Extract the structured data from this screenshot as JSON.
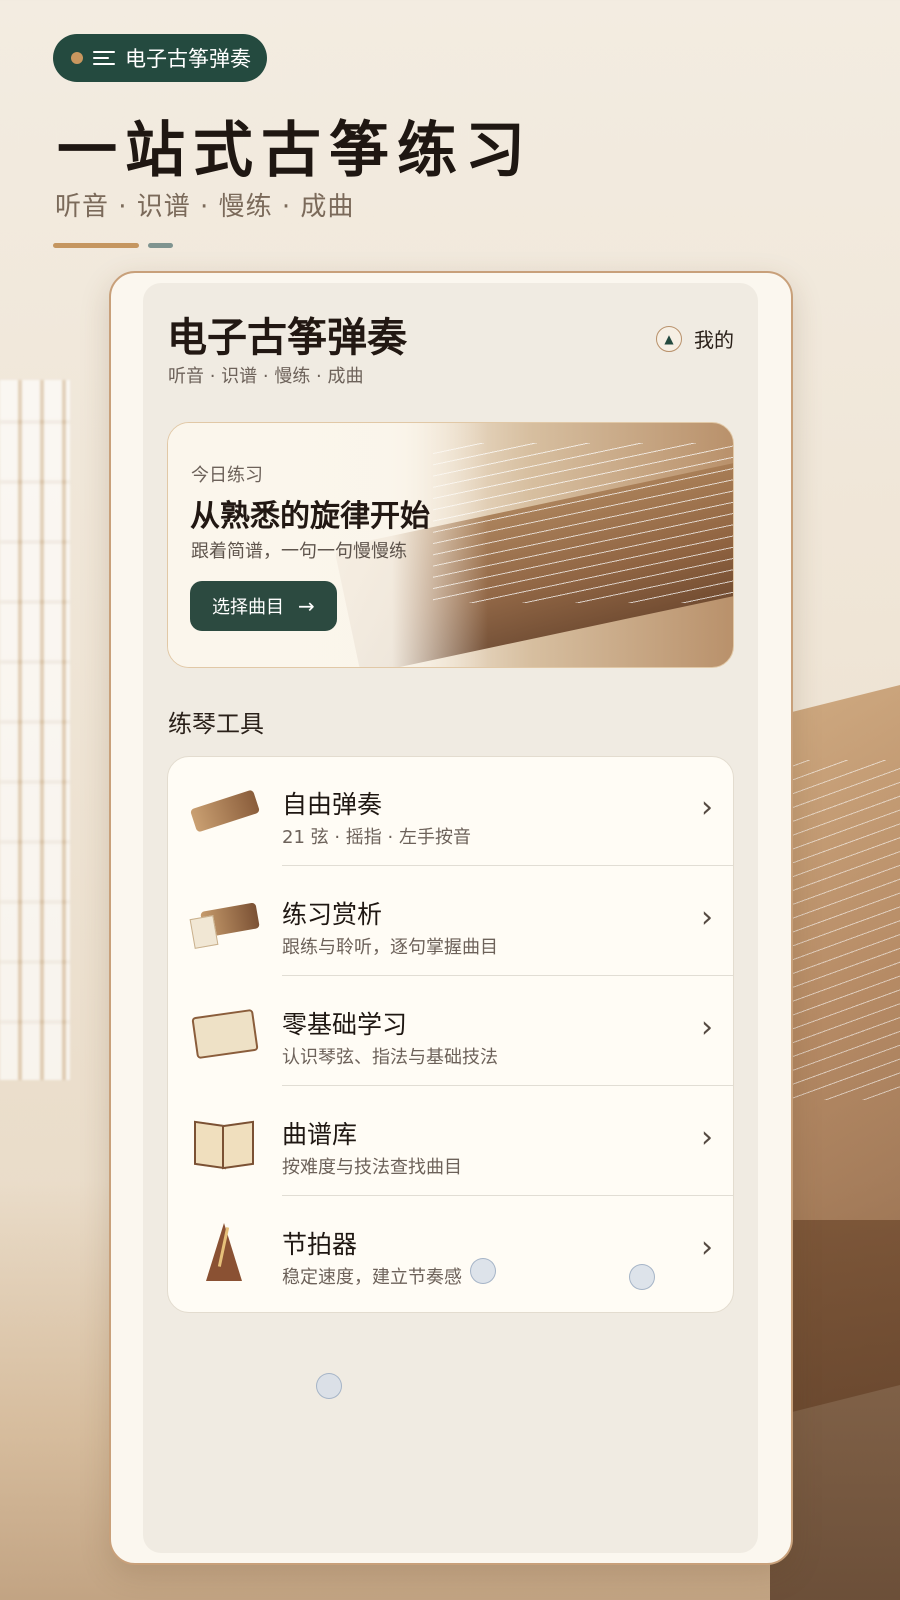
{
  "header": {
    "app_name": "电子古筝弹奏",
    "hero_title": "一站式古筝练习",
    "hero_subtitle": "听音 · 识谱 · 慢练 · 成曲"
  },
  "app_screen": {
    "title": "电子古筝弹奏",
    "subtitle": "听音 · 识谱 · 慢练 · 成曲",
    "me_label": "我的",
    "banner": {
      "kicker": "今日练习",
      "title": "从熟悉的旋律开始",
      "description": "跟着简谱，一句一句慢慢练",
      "button_label": "选择曲目",
      "button_arrow": "→"
    },
    "tools_section_title": "练琴工具",
    "tools": [
      {
        "name": "自由弹奏",
        "desc": "21 弦 · 摇指 · 左手按音",
        "icon": "guzheng-icon"
      },
      {
        "name": "练习赏析",
        "desc": "跟练与聆听，逐句掌握曲目",
        "icon": "guzheng-sound-icon"
      },
      {
        "name": "零基础学习",
        "desc": "认识琴弦、指法与基础技法",
        "icon": "scroll-brush-icon"
      },
      {
        "name": "曲谱库",
        "desc": "按难度与技法查找曲目",
        "icon": "book-icon"
      },
      {
        "name": "节拍器",
        "desc": "稳定速度，建立节奏感",
        "icon": "metronome-icon"
      }
    ],
    "chevron": "›"
  },
  "colors": {
    "accent_green": "#244a3f",
    "accent_gold": "#c59660",
    "text_dark": "#221813"
  }
}
